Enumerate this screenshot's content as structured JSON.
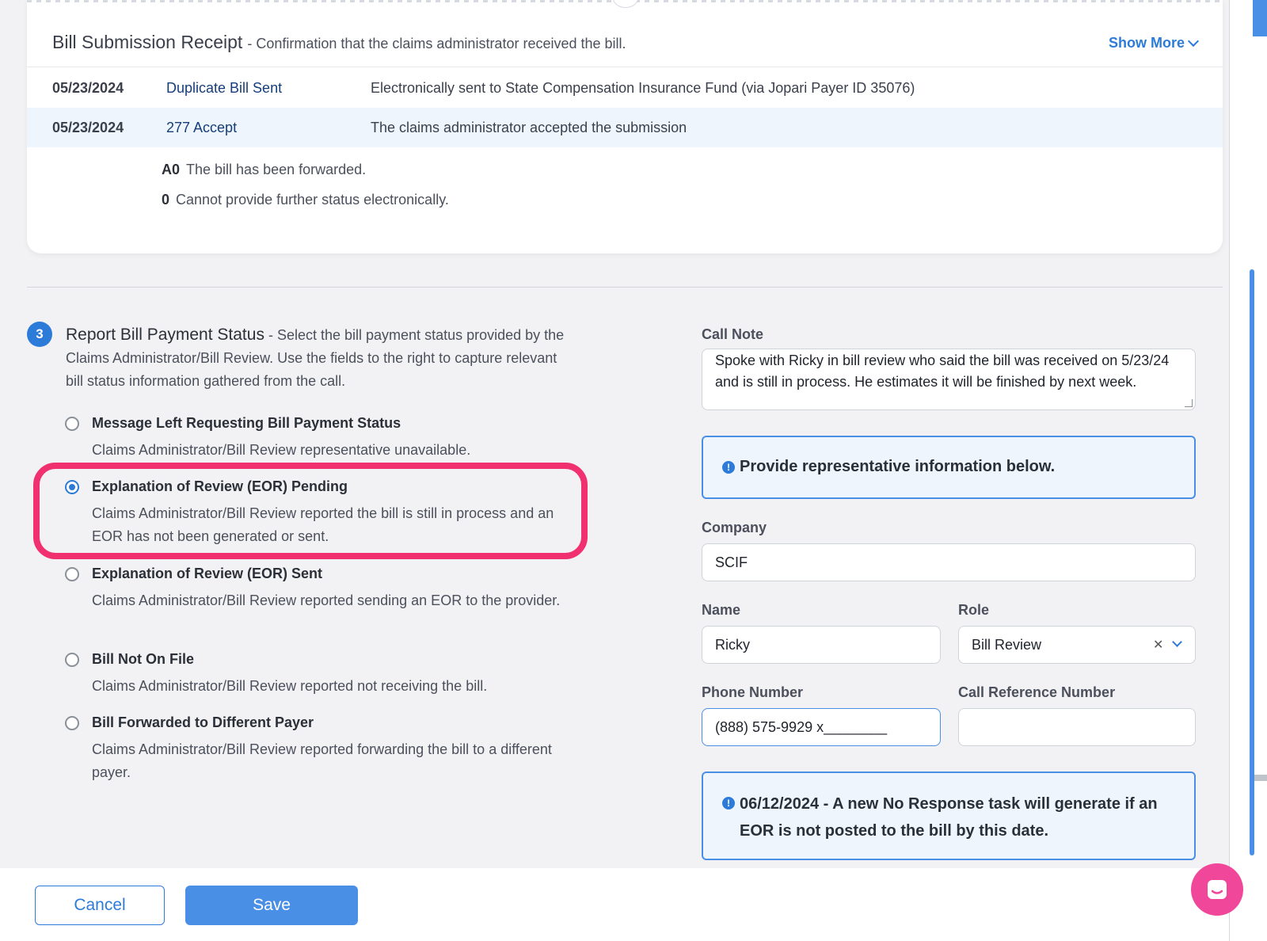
{
  "receipt": {
    "title": "Bill Submission Receipt",
    "subtitle": "- Confirmation that the claims administrator received the bill.",
    "show_more": "Show More",
    "rows": [
      {
        "date": "05/23/2024",
        "status": "Duplicate Bill Sent",
        "description": "Electronically sent to State Compensation Insurance Fund (via Jopari Payer ID 35076)"
      },
      {
        "date": "05/23/2024",
        "status": "277 Accept",
        "description": "The claims administrator accepted the submission"
      }
    ],
    "codes": [
      {
        "code": "A0",
        "text": "The bill has been forwarded."
      },
      {
        "code": "0",
        "text": "Cannot provide further status electronically."
      }
    ]
  },
  "step": {
    "number": "3",
    "title": "Report Bill Payment Status",
    "description": "- Select the bill payment status provided by the Claims Administrator/Bill Review. Use the fields to the right to capture relevant bill status information gathered from the call."
  },
  "options": [
    {
      "title": "Message Left Requesting Bill Payment Status",
      "description": "Claims Administrator/Bill Review representative unavailable."
    },
    {
      "title": "Explanation of Review (EOR) Pending",
      "description": "Claims Administrator/Bill Review reported the bill is still in process and an EOR has not been generated or sent."
    },
    {
      "title": "Explanation of Review (EOR) Sent",
      "description": "Claims Administrator/Bill Review reported sending an EOR to the provider."
    },
    {
      "title": "Bill Not On File",
      "description": "Claims Administrator/Bill Review reported not receiving the bill."
    },
    {
      "title": "Bill Forwarded to Different Payer",
      "description": "Claims Administrator/Bill Review reported forwarding the bill to a different payer."
    }
  ],
  "selected_option": "Explanation of Review (EOR) Pending",
  "form": {
    "call_note_label": "Call Note",
    "call_note_value": "Spoke with Ricky in bill review who said the bill was received on 5/23/24 and is still in process. He estimates it will be finished by next week.",
    "info_message": "Provide representative information below.",
    "company_label": "Company",
    "company_value": "SCIF",
    "name_label": "Name",
    "name_value": "Ricky",
    "role_label": "Role",
    "role_value": "Bill Review",
    "phone_label": "Phone Number",
    "phone_value": "(888) 575-9929 x________",
    "call_ref_label": "Call Reference Number",
    "call_ref_value": "",
    "deadline_message": "06/12/2024 - A new No Response task will generate if an EOR is not posted to the bill by this date."
  },
  "footer": {
    "cancel_label": "Cancel",
    "save_label": "Save"
  },
  "colors": {
    "accent": "#2d7bd8",
    "highlight": "#f0306f",
    "chat": "#f0479a"
  }
}
